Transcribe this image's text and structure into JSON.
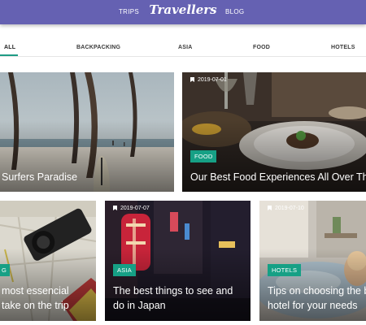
{
  "header": {
    "logo": "Travellers",
    "nav_left": "TRIPS",
    "nav_right": "BLOG"
  },
  "filters": [
    "ALL",
    "BACKPACKING",
    "ASIA",
    "FOOD",
    "HOTELS"
  ],
  "cards": {
    "surfers": {
      "title": "Surfers Paradise"
    },
    "food": {
      "date": "2019-07-01",
      "badge": "FOOD",
      "title": "Our Best Food Experiences All Over The"
    },
    "essential": {
      "badge": "G",
      "title_line1": "most essencial",
      "title_line2": "take on the trip"
    },
    "japan": {
      "date": "2019-07-07",
      "badge": "ASIA",
      "title_line1": "The best things to see and",
      "title_line2": "do in Japan"
    },
    "hotels": {
      "date": "2019-07-10",
      "badge": "HOTELS",
      "title_line1": "Tips on choosing the b",
      "title_line2": "hotel for your needs"
    }
  },
  "colors": {
    "header": "#6561b2",
    "accent": "#16a085"
  }
}
